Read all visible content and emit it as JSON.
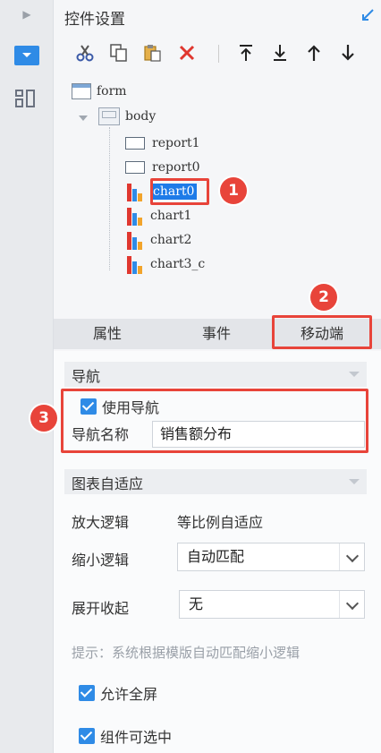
{
  "panel": {
    "title": "控件设置"
  },
  "tree": {
    "form": "form",
    "body": "body",
    "items": [
      "report1",
      "report0",
      "chart0",
      "chart1",
      "chart2",
      "chart3_c"
    ]
  },
  "callouts": [
    "1",
    "2",
    "3"
  ],
  "tabs": [
    "属性",
    "事件",
    "移动端"
  ],
  "nav_section": {
    "title": "导航",
    "use_nav_label": "使用导航",
    "use_nav_checked": true,
    "nav_name_label": "导航名称",
    "nav_name_value": "销售额分布"
  },
  "adaptive_section": {
    "title": "图表自适应",
    "zoom_in_label": "放大逻辑",
    "zoom_in_value": "等比例自适应",
    "zoom_out_label": "缩小逻辑",
    "zoom_out_value": "自动匹配",
    "expand_label": "展开收起",
    "expand_value": "无",
    "hint": "提示：系统根据模版自动匹配缩小逻辑",
    "allow_fullscreen_label": "允许全屏",
    "allow_fullscreen_checked": true,
    "selectable_label": "组件可选中",
    "selectable_checked": true
  },
  "colors": {
    "accent": "#2f8be6",
    "callout": "#e8443a",
    "selected": "#1e7be8"
  }
}
